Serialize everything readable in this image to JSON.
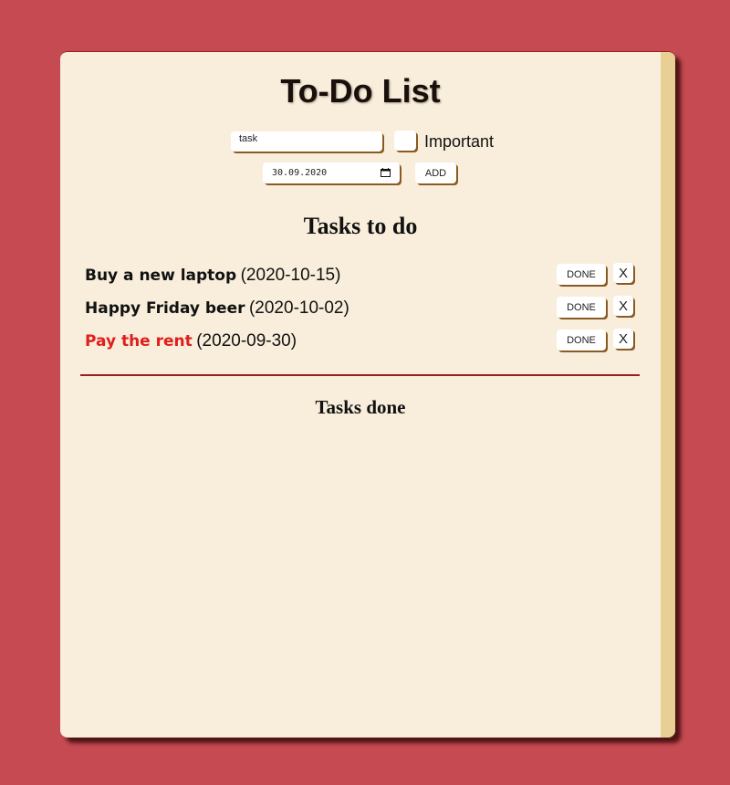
{
  "app": {
    "title": "To-Do List"
  },
  "form": {
    "task_value": "task",
    "important_label": "Important",
    "important_checked": false,
    "date_value": "30.09.2020",
    "add_label": "ADD"
  },
  "todo": {
    "heading": "Tasks to do",
    "done_label": "DONE",
    "delete_label": "X",
    "items": [
      {
        "name": "Buy a new laptop",
        "date": "(2020-10-15)",
        "important": false
      },
      {
        "name": "Happy Friday beer",
        "date": "(2020-10-02)",
        "important": false
      },
      {
        "name": "Pay the rent",
        "date": "(2020-09-30)",
        "important": true
      }
    ]
  },
  "done": {
    "heading": "Tasks done",
    "items": []
  },
  "colors": {
    "background": "#c54a52",
    "card": "#f8eedb",
    "important": "#e01e1e",
    "divider": "#9a1e24",
    "scrollbar": "#e8cf93"
  },
  "icons": {
    "date_picker": "calendar-icon"
  }
}
